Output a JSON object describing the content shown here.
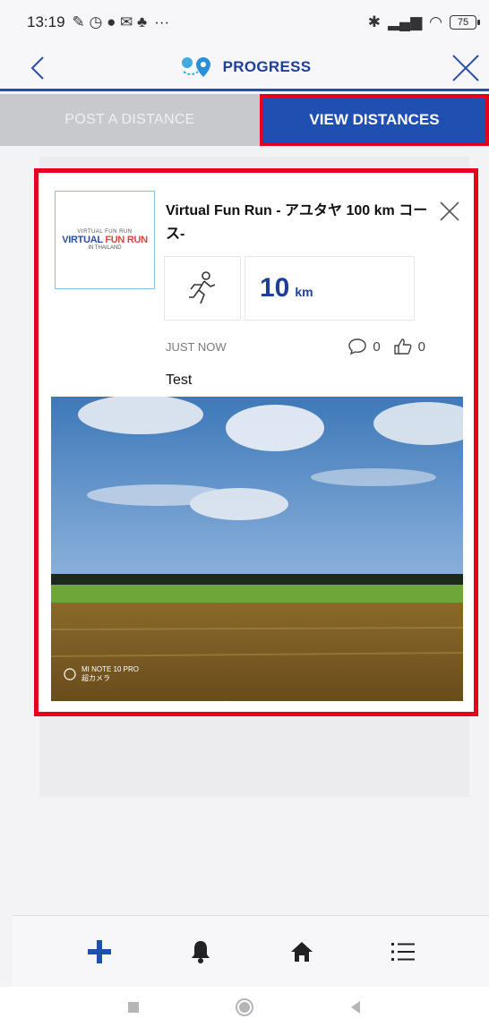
{
  "status": {
    "time": "13:19",
    "more": "···",
    "battery": "75"
  },
  "header": {
    "title": "PROGRESS"
  },
  "tabs": {
    "post": "POST A DISTANCE",
    "view": "VIEW DISTANCES"
  },
  "card": {
    "title": "Virtual Fun Run - アユタヤ 100 km コース-",
    "thumb": {
      "logo_left": "VIRTUAL",
      "logo_right": "FUN RUN",
      "top": "VIRTUAL FUN RUN",
      "sub": "IN THAILAND"
    },
    "activity_icon": "running-person-icon",
    "distance_value": "10",
    "distance_unit": "km",
    "time": "JUST NOW",
    "comments": "0",
    "likes": "0",
    "text": "Test",
    "photo_watermark_line1": "MI NOTE 10 PRO",
    "photo_watermark_line2": "超カメラ"
  },
  "colors": {
    "brand_blue": "#1f4fb0",
    "highlight_red": "#e6001c",
    "tab_inactive": "#c7c9cd"
  },
  "nav": {
    "items": [
      "plus-icon",
      "bell-icon",
      "home-icon",
      "list-icon"
    ]
  }
}
